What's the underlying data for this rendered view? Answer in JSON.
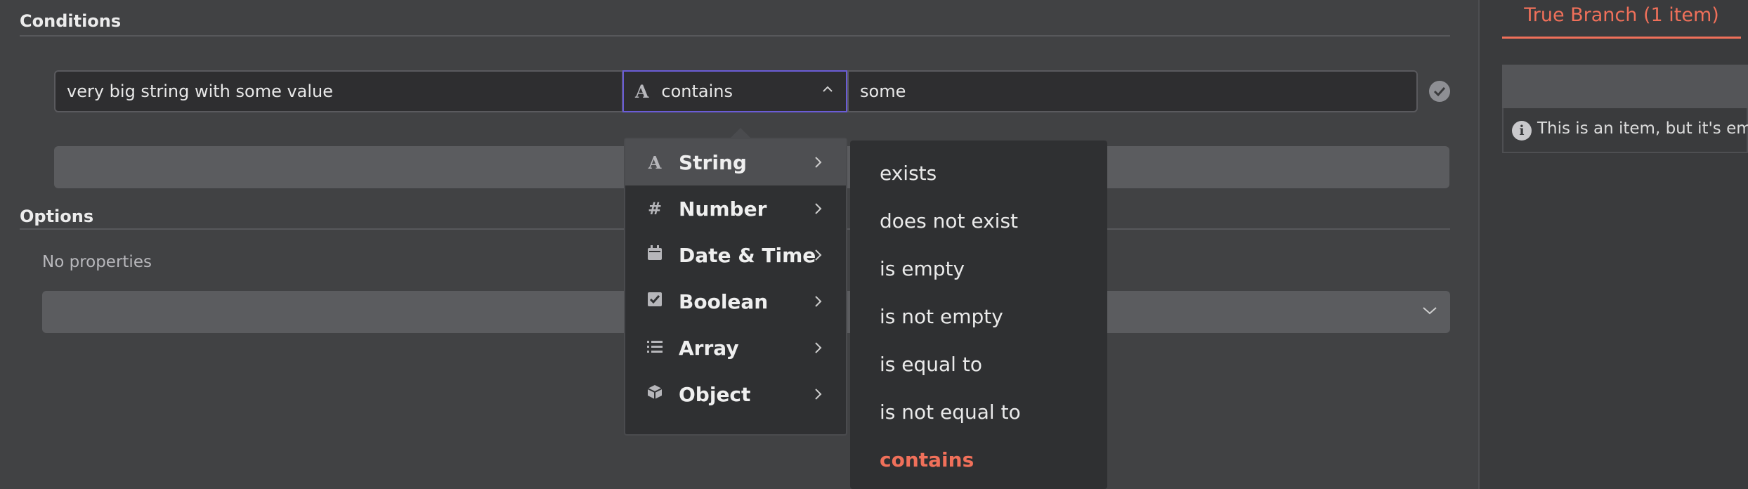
{
  "conditions": {
    "section_title": "Conditions",
    "value1": "very big string with some value",
    "operator_label": "contains",
    "value2": "some"
  },
  "options": {
    "section_title": "Options",
    "empty_text": "No properties"
  },
  "type_menu": {
    "items": [
      {
        "label": "String",
        "icon": "string-icon"
      },
      {
        "label": "Number",
        "icon": "number-icon"
      },
      {
        "label": "Date & Time",
        "icon": "calendar-icon"
      },
      {
        "label": "Boolean",
        "icon": "checkbox-icon"
      },
      {
        "label": "Array",
        "icon": "list-icon"
      },
      {
        "label": "Object",
        "icon": "cube-icon"
      }
    ],
    "active": "String"
  },
  "operator_menu": {
    "items": [
      "exists",
      "does not exist",
      "is empty",
      "is not empty",
      "is equal to",
      "is not equal to",
      "contains"
    ],
    "selected": "contains"
  },
  "output_panel": {
    "tab_label": "True Branch (1 item)",
    "info_text": "This is an item, but it's em"
  },
  "colors": {
    "accent": "#f0705a",
    "focus_border": "#6a5cd6",
    "background": "#414244"
  }
}
